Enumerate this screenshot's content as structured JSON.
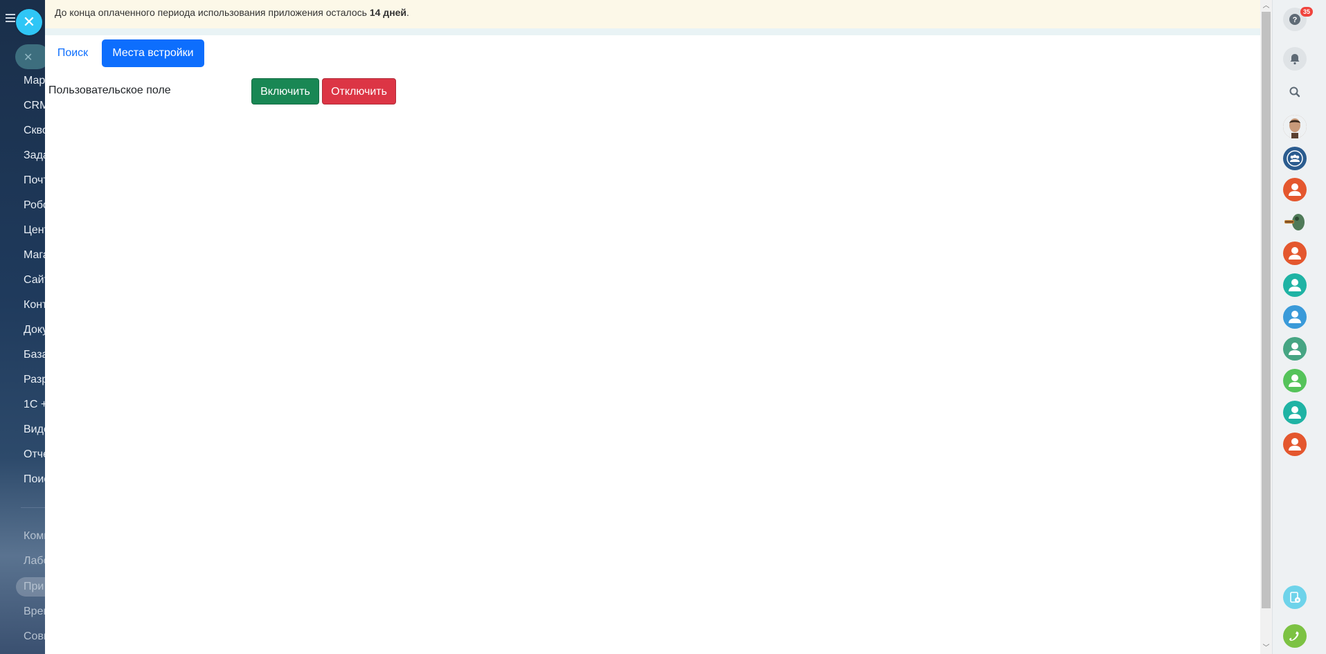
{
  "sidebar": {
    "items": [
      {
        "label": "Мар"
      },
      {
        "label": "CRM"
      },
      {
        "label": "Скво"
      },
      {
        "label": "Зада"
      },
      {
        "label": "Почт"
      },
      {
        "label": "Робо"
      },
      {
        "label": "Цент"
      },
      {
        "label": "Мага"
      },
      {
        "label": "Сайт"
      },
      {
        "label": "Конт"
      },
      {
        "label": "Доку"
      },
      {
        "label": "База"
      },
      {
        "label": "Разр"
      },
      {
        "label": "1С +"
      },
      {
        "label": "Виде"
      },
      {
        "label": "Отче"
      },
      {
        "label": "Поис"
      },
      {
        "label": "Комп"
      },
      {
        "label": "Лабо"
      },
      {
        "label": "При"
      },
      {
        "label": "Врем"
      },
      {
        "label": "Совм"
      }
    ]
  },
  "trial": {
    "prefix": "До конца оплаченного периода использования приложения осталось ",
    "days": "14 дней",
    "suffix": "."
  },
  "tabs": {
    "search": "Поиск",
    "placements": "Места встройки"
  },
  "row": {
    "label": "Пользовательское поле",
    "enable": "Включить",
    "disable": "Отключить"
  },
  "right_bar": {
    "help_badge": "35",
    "avatar_colors": [
      "#2b5c8f",
      "#e4572e",
      "#e4572e",
      "#1fb3a4",
      "#3a9ad9",
      "#46a583",
      "#55c35a",
      "#1fb3a4",
      "#e4572e"
    ]
  },
  "colors": {
    "primary": "#0d6efd",
    "success": "#198754",
    "danger": "#dc3545",
    "close": "#2fc6f6"
  }
}
